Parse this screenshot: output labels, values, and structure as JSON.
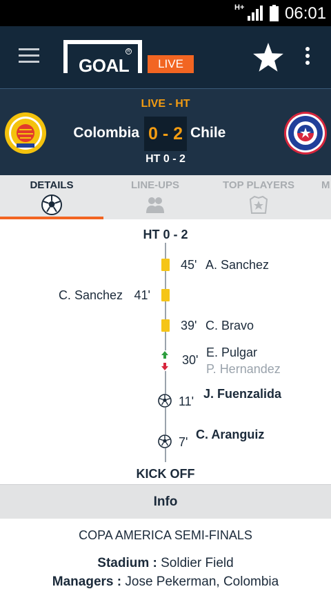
{
  "status_bar": {
    "network": "H+",
    "time": "06:01",
    "icons": [
      "signal-icon",
      "battery-icon"
    ]
  },
  "app_bar": {
    "logo_text": "GOAL",
    "live_badge": "LIVE",
    "icons": [
      "menu-icon",
      "star-icon",
      "overflow-icon"
    ]
  },
  "match": {
    "status": "LIVE - HT",
    "home_team": "Colombia",
    "away_team": "Chile",
    "score": "0 - 2",
    "halftime": "HT 0 - 2"
  },
  "tabs": [
    {
      "label": "DETAILS",
      "icon": "soccer-ball-icon",
      "active": true
    },
    {
      "label": "LINE-UPS",
      "icon": "players-icon",
      "active": false
    },
    {
      "label": "TOP PLAYERS",
      "icon": "star-badge-icon",
      "active": false
    },
    {
      "label": "M",
      "icon": "",
      "active": false
    }
  ],
  "timeline": {
    "top_label": "HT 0 - 2",
    "bottom_label": "KICK OFF",
    "events": [
      {
        "side": "away",
        "type": "yellow-card",
        "minute": "45'",
        "player": "A. Sanchez"
      },
      {
        "side": "home",
        "type": "yellow-card",
        "minute": "41'",
        "player": "C. Sanchez"
      },
      {
        "side": "away",
        "type": "yellow-card",
        "minute": "39'",
        "player": "C. Bravo"
      },
      {
        "side": "away",
        "type": "substitution",
        "minute": "30'",
        "player_in": "E. Pulgar",
        "player_out": "P. Hernandez"
      },
      {
        "side": "away",
        "type": "goal",
        "minute": "11'",
        "player": "J. Fuenzalida"
      },
      {
        "side": "away",
        "type": "goal",
        "minute": "7'",
        "player": "C. Aranguiz"
      }
    ]
  },
  "info": {
    "header": "Info",
    "competition": "COPA AMERICA SEMI-FINALS",
    "stadium_label": "Stadium :",
    "stadium_value": "Soldier Field",
    "managers_label": "Managers :",
    "managers_value": "Jose Pekerman, Colombia"
  },
  "colors": {
    "appbar": "#14283a",
    "scorebar": "#1e3246",
    "accent": "#f26522",
    "score": "#f39c12",
    "yellow_card": "#f5c518"
  }
}
